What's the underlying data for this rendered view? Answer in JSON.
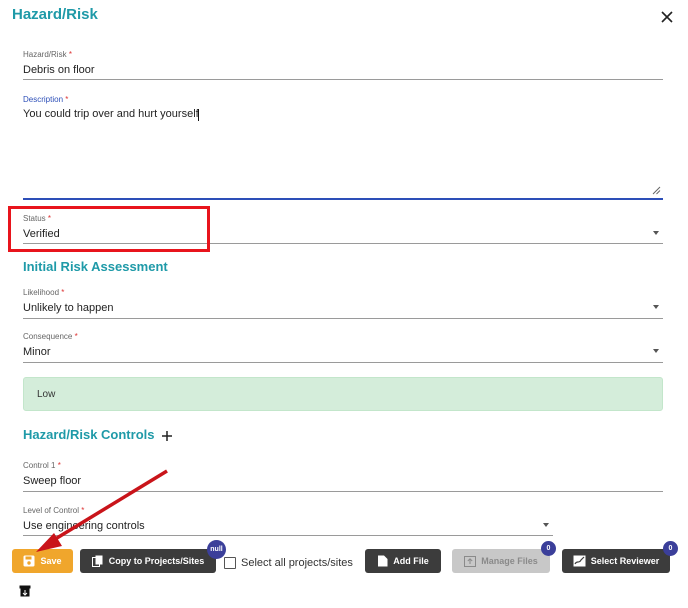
{
  "dialog": {
    "title": "Hazard/Risk",
    "close_icon": "close-icon"
  },
  "fields": {
    "hazard": {
      "label": "Hazard/Risk",
      "required": "*",
      "value": "Debris on floor"
    },
    "description": {
      "label": "Description",
      "required": "*",
      "value": "You could trip over and hurt yourself"
    },
    "status": {
      "label": "Status",
      "required": "*",
      "value": "Verified"
    }
  },
  "initial_risk": {
    "heading": "Initial Risk Assessment",
    "likelihood": {
      "label": "Likelihood",
      "required": "*",
      "value": "Unlikely to happen"
    },
    "consequence": {
      "label": "Consequence",
      "required": "*",
      "value": "Minor"
    },
    "rating": "Low"
  },
  "controls": {
    "heading": "Hazard/Risk Controls",
    "add_icon": "plus-icon",
    "control1": {
      "label": "Control 1",
      "required": "*",
      "value": "Sweep floor"
    },
    "level": {
      "label": "Level of Control",
      "required": "*",
      "value": "Use engineering controls"
    }
  },
  "toolbar": {
    "save": "Save",
    "copy": "Copy to Projects/Sites",
    "copy_badge": "null",
    "select_all": "Select all projects/sites",
    "add_file": "Add File",
    "manage_files": "Manage Files",
    "manage_badge": "0",
    "select_reviewer": "Select Reviewer",
    "reviewer_badge": "0"
  },
  "colors": {
    "accent": "#1f9aa8",
    "save": "#f0a62c",
    "focus": "#2d4fb8",
    "risk_low": "#d4edda",
    "annotation": "#e8141c"
  }
}
